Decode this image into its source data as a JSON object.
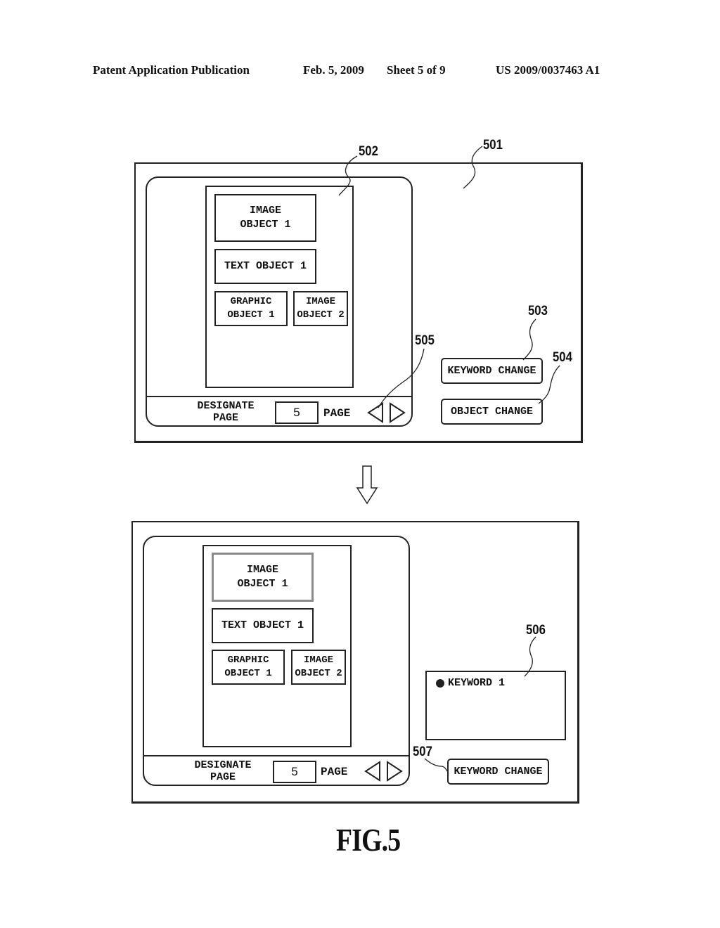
{
  "header": {
    "publication": "Patent Application Publication",
    "date": "Feb. 5, 2009",
    "sheet": "Sheet 5 of 9",
    "number": "US 2009/0037463 A1"
  },
  "references": {
    "screen": "501",
    "page_area": "502",
    "keyword_change_button": "503",
    "object_change_button": "504",
    "page_nav_buttons": "505",
    "keyword_list": "506",
    "keyword_change_button_2": "507"
  },
  "top_screen": {
    "objects": {
      "image_object_1": [
        "IMAGE",
        "OBJECT 1"
      ],
      "text_object_1": "TEXT OBJECT 1",
      "graphic_object_1": [
        "GRAPHIC",
        "OBJECT 1"
      ],
      "image_object_2": [
        "IMAGE",
        "OBJECT 2"
      ]
    },
    "page_bar": {
      "label_line1": "DESIGNATE",
      "label_line2": "PAGE",
      "page_value": "5",
      "page_word": "PAGE",
      "prev_icon": "◁",
      "next_icon": "▷"
    },
    "buttons": {
      "keyword_change": "KEYWORD CHANGE",
      "object_change": "OBJECT CHANGE"
    }
  },
  "bottom_screen": {
    "objects": {
      "image_object_1": [
        "IMAGE",
        "OBJECT 1"
      ],
      "text_object_1": "TEXT OBJECT 1",
      "graphic_object_1": [
        "GRAPHIC",
        "OBJECT 1"
      ],
      "image_object_2": [
        "IMAGE",
        "OBJECT 2"
      ],
      "selected": "image_object_1"
    },
    "page_bar": {
      "label_line1": "DESIGNATE",
      "label_line2": "PAGE",
      "page_value": "5",
      "page_word": "PAGE",
      "prev_icon": "◁",
      "next_icon": "▷"
    },
    "keyword_list": {
      "items": [
        "KEYWORD 1"
      ]
    },
    "buttons": {
      "keyword_change": "KEYWORD CHANGE"
    }
  },
  "transition_icon": "down-arrow",
  "figure_label": "FIG.5"
}
